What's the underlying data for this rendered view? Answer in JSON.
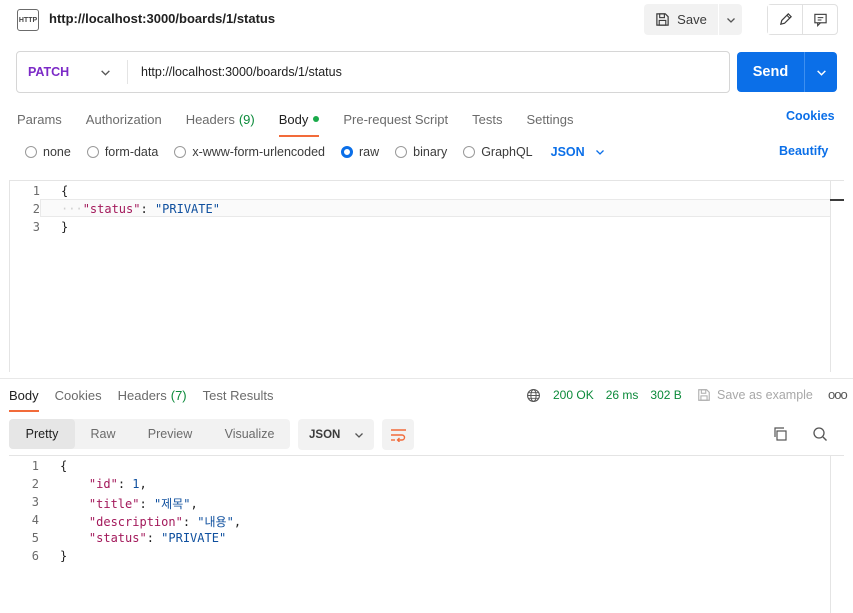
{
  "header": {
    "icon_text": "HTTP",
    "title": "http://localhost:3000/boards/1/status",
    "save_label": "Save",
    "icons": [
      "http-icon",
      "save-icon",
      "chevron-down-icon",
      "pencil-icon",
      "comment-icon"
    ]
  },
  "request": {
    "method": "PATCH",
    "url": "http://localhost:3000/boards/1/status",
    "send_label": "Send"
  },
  "request_tabs": [
    {
      "label": "Params",
      "count": ""
    },
    {
      "label": "Authorization",
      "count": ""
    },
    {
      "label": "Headers",
      "count": "(9)"
    },
    {
      "label": "Body",
      "count": ""
    },
    {
      "label": "Pre-request Script",
      "count": ""
    },
    {
      "label": "Tests",
      "count": ""
    },
    {
      "label": "Settings",
      "count": ""
    }
  ],
  "cookies_label": "Cookies",
  "body_types": [
    "none",
    "form-data",
    "x-www-form-urlencoded",
    "raw",
    "binary",
    "GraphQL"
  ],
  "body_format": "JSON",
  "beautify_label": "Beautify",
  "request_body": {
    "line_numbers": [
      "1",
      "2",
      "3"
    ],
    "open": "{",
    "close": "}",
    "key": "\"status\"",
    "colon": ": ",
    "value": "\"PRIVATE\""
  },
  "response_tabs": [
    {
      "label": "Body",
      "count": ""
    },
    {
      "label": "Cookies",
      "count": ""
    },
    {
      "label": "Headers",
      "count": "(7)"
    },
    {
      "label": "Test Results",
      "count": ""
    }
  ],
  "response_status": {
    "code": "200 OK",
    "time": "26 ms",
    "size": "302 B",
    "save_example": "Save as example"
  },
  "response_views": [
    "Pretty",
    "Raw",
    "Preview",
    "Visualize"
  ],
  "response_format": "JSON",
  "response_body": {
    "line_numbers": [
      "1",
      "2",
      "3",
      "4",
      "5",
      "6"
    ],
    "open": "{",
    "close": "}",
    "lines": [
      {
        "key": "\"id\"",
        "value": "1",
        "comma": ","
      },
      {
        "key": "\"title\"",
        "value": "\"제목\"",
        "comma": ","
      },
      {
        "key": "\"description\"",
        "value": "\"내용\"",
        "comma": ","
      },
      {
        "key": "\"status\"",
        "value": "\"PRIVATE\"",
        "comma": ""
      }
    ]
  },
  "colors": {
    "accent": "#0b6fe8",
    "method": "#7c2ac7",
    "success": "#0b8a3a",
    "active_tab": "#f26b3a"
  }
}
